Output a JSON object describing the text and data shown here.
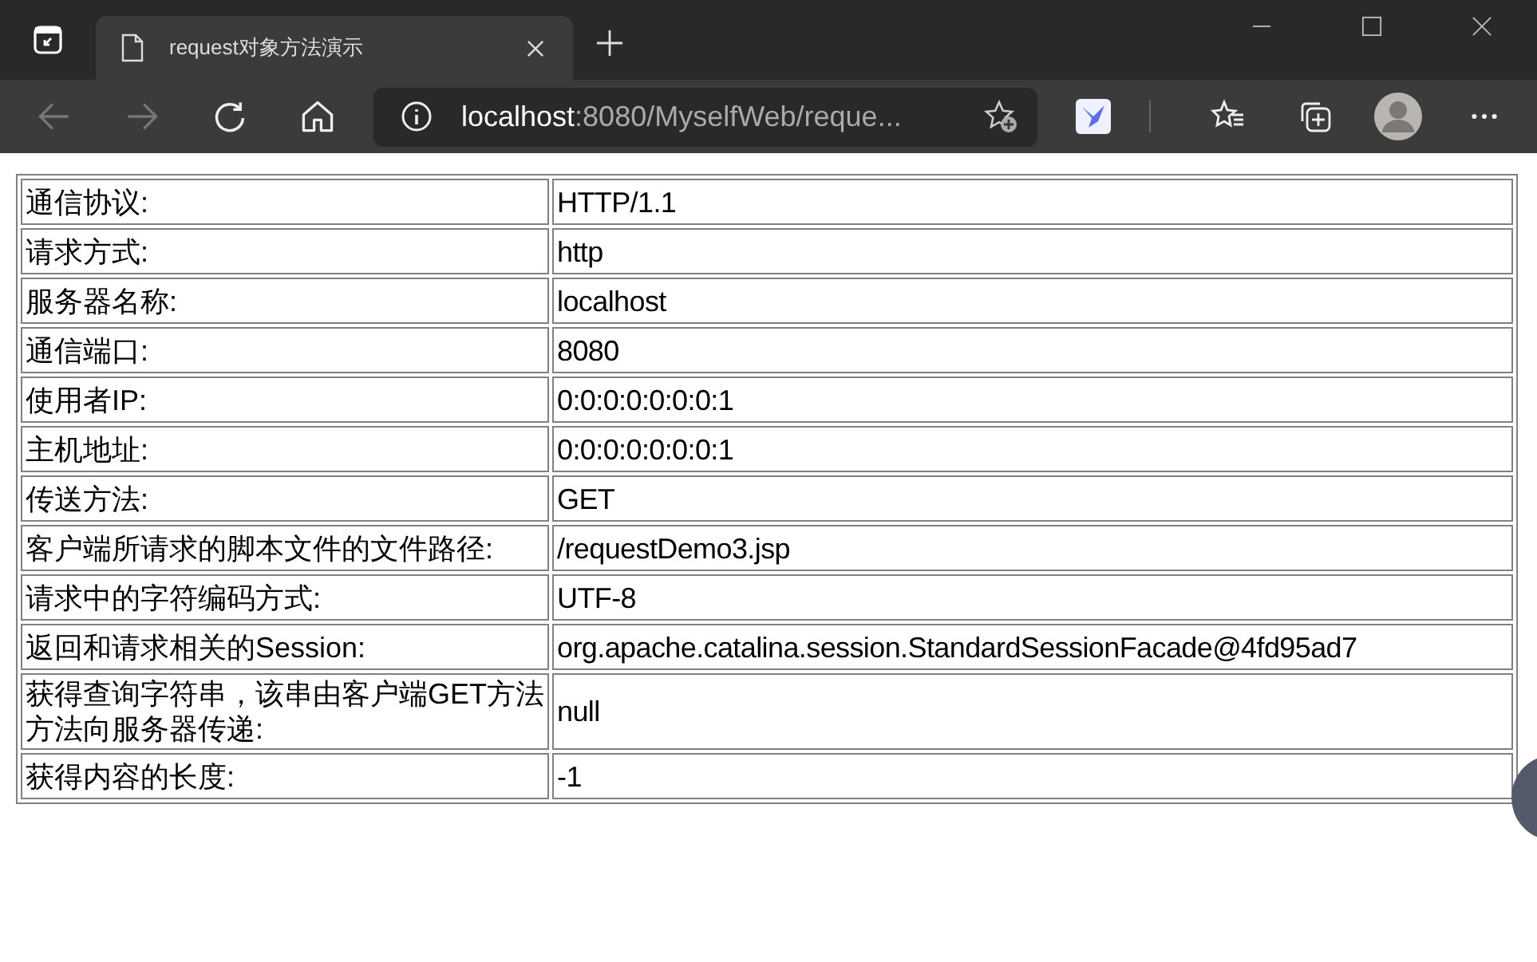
{
  "browser": {
    "tab": {
      "title": "request对象方法演示",
      "selected": true
    },
    "address": {
      "host": "localhost",
      "path": ":8080/MyselfWeb/reque..."
    }
  },
  "table": {
    "rows": [
      {
        "label": "通信协议:",
        "value": "HTTP/1.1"
      },
      {
        "label": "请求方式:",
        "value": "http"
      },
      {
        "label": "服务器名称:",
        "value": "localhost"
      },
      {
        "label": "通信端口:",
        "value": "8080"
      },
      {
        "label": "使用者IP:",
        "value": "0:0:0:0:0:0:0:1"
      },
      {
        "label": "主机地址:",
        "value": "0:0:0:0:0:0:0:1"
      },
      {
        "label": "传送方法:",
        "value": "GET"
      },
      {
        "label": "客户端所请求的脚本文件的文件路径:",
        "value": "/requestDemo3.jsp"
      },
      {
        "label": "请求中的字符编码方式:",
        "value": "UTF-8"
      },
      {
        "label": "返回和请求相关的Session:",
        "value": "org.apache.catalina.session.StandardSessionFacade@4fd95ad7"
      },
      {
        "label": "获得查询字符串，该串由客户端GET方法方法向服务器传递:",
        "value": "null"
      },
      {
        "label": "获得内容的长度:",
        "value": "-1"
      }
    ]
  }
}
